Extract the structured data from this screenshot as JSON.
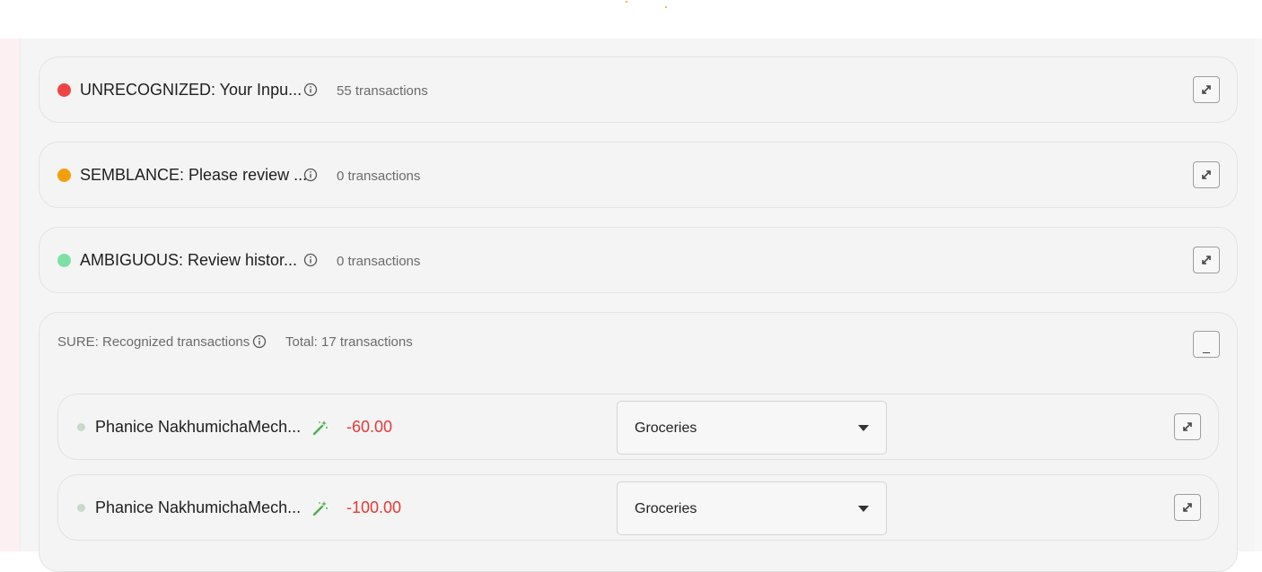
{
  "colors": {
    "unrecognized": "#ef4444",
    "semblance": "#f59e0b",
    "ambiguous": "#7ee0a6",
    "amount_negative": "#e53935",
    "wand": "#4caf50"
  },
  "groups": [
    {
      "status": "unrecognized",
      "title": "UNRECOGNIZED: Your Inpu...",
      "count": "55 transactions",
      "info_icon": "info-icon",
      "action_icon": "expand-icon"
    },
    {
      "status": "semblance",
      "title": "SEMBLANCE: Please review ...",
      "count": "0 transactions",
      "info_icon": "info-icon",
      "action_icon": "expand-icon"
    },
    {
      "status": "ambiguous",
      "title": "AMBIGUOUS: Review histor...",
      "count": "0 transactions",
      "info_icon": "info-icon",
      "action_icon": "expand-icon"
    }
  ],
  "sure": {
    "title": "SURE: Recognized transactions",
    "total": "Total: 17 transactions",
    "minimize_label": "_",
    "transactions": [
      {
        "name": "Phanice NakhumichaMech...",
        "amount": "-60.00",
        "category": "Groceries",
        "icon": "magic-wand-icon"
      },
      {
        "name": "Phanice NakhumichaMech...",
        "amount": "-100.00",
        "category": "Groceries",
        "icon": "magic-wand-icon"
      }
    ]
  }
}
